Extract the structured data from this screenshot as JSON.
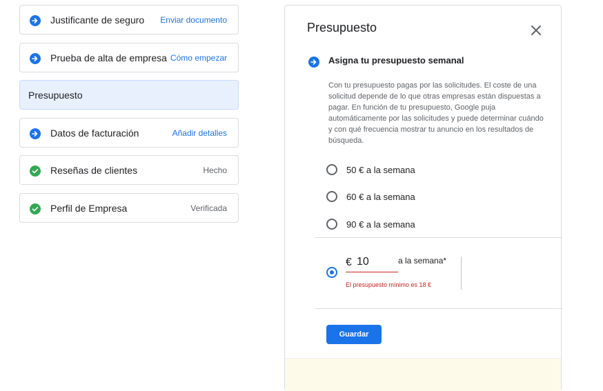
{
  "colors": {
    "accent": "#1a73e8",
    "success": "#34a853",
    "error": "#c5221f"
  },
  "tasks": [
    {
      "label": "Justificante de seguro",
      "action": "Enviar documento",
      "icon": "arrow-right-icon"
    },
    {
      "label": "Prueba de alta de empresa",
      "action": "Cómo empezar",
      "icon": "arrow-right-icon"
    },
    {
      "label": "Presupuesto",
      "selected": true
    },
    {
      "label": "Datos de facturación",
      "action": "Añadir detalles",
      "icon": "arrow-right-icon"
    },
    {
      "label": "Reseñas de clientes",
      "action": "Hecho",
      "icon": "check-circle-icon"
    },
    {
      "label": "Perfil de Empresa",
      "action": "Verificada",
      "icon": "check-circle-icon"
    }
  ],
  "panel": {
    "title": "Presupuesto",
    "section_title": "Asigna tu presupuesto semanal",
    "description": "Con tu presupuesto pagas por las solicitudes. El coste de una solicitud depende de lo que otras empresas están dispuestas a pagar. En función de tu presupuesto, Google puja automáticamente por las solicitudes y puede determinar cuándo y con qué frecuencia mostrar tu anuncio en los resultados de búsqueda.",
    "options": [
      {
        "label": "50 € a la semana",
        "selected": false
      },
      {
        "label": "60 € a la semana",
        "selected": false
      },
      {
        "label": "90 € a la semana",
        "selected": false
      }
    ],
    "custom": {
      "selected": true,
      "currency": "€",
      "value": "10",
      "suffix": "a la semana*",
      "error": "El presupuesto mínimo es 18 €"
    },
    "save_label": "Guardar"
  }
}
